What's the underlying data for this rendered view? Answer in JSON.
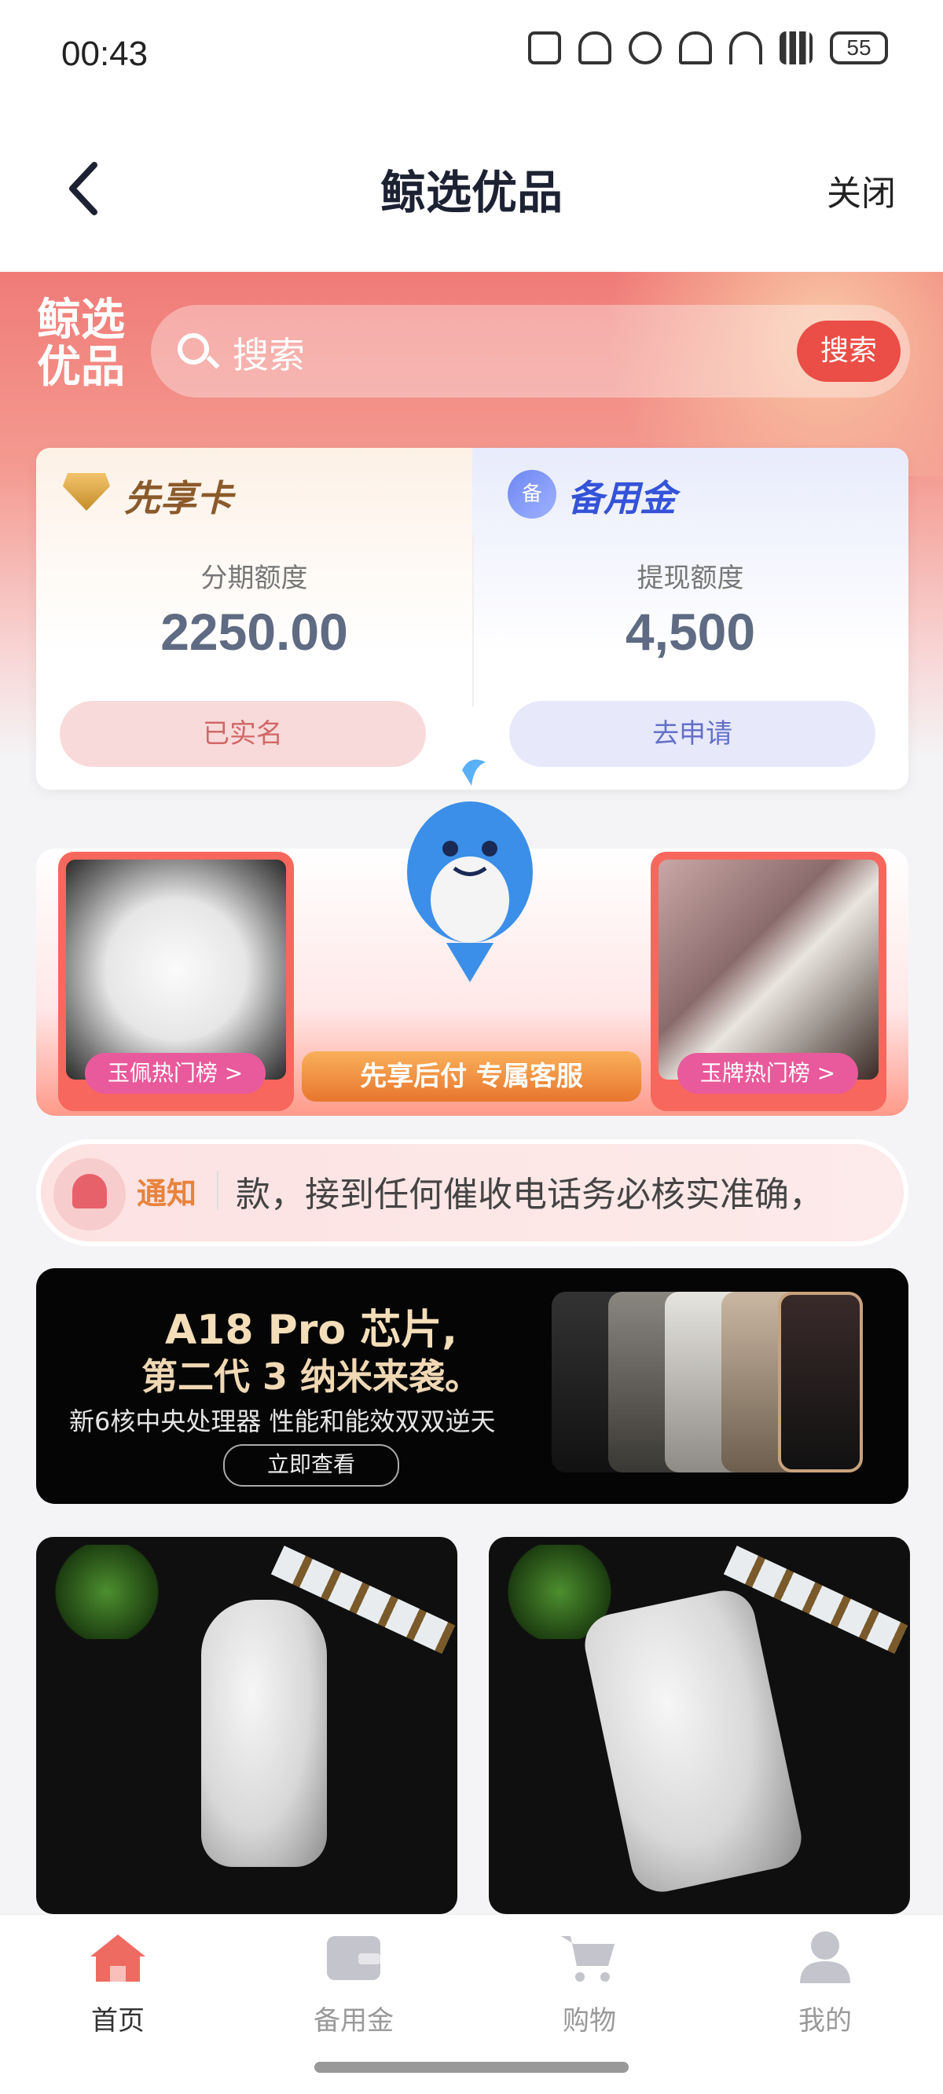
{
  "status_bar": {
    "time": "00:43",
    "battery": "55"
  },
  "nav": {
    "title": "鲸选优品",
    "close_label": "关闭"
  },
  "header": {
    "logo_text": "鲸选优品",
    "search_placeholder": "搜索",
    "search_button": "搜索"
  },
  "card": {
    "left": {
      "title": "先享卡",
      "sub_label": "分期额度",
      "value": "2250.00",
      "button": "已实名"
    },
    "right": {
      "icon_text": "备",
      "title": "备用金",
      "sub_label": "提现额度",
      "value": "4,500",
      "button": "去申请"
    }
  },
  "promo": {
    "left_tag": "玉佩热门榜 >",
    "right_tag": "玉牌热门榜 >",
    "center_button": "先享后付 专属客服"
  },
  "notice": {
    "label": "通知",
    "text": "款，接到任何催收电话务必核实准确，"
  },
  "ad": {
    "title": "A18 Pro 芯片,",
    "subtitle": "第二代 3 纳米来袭。",
    "desc": "新6核中央处理器  性能和能效双双逆天",
    "button": "立即查看"
  },
  "tabs": [
    {
      "label": "首页",
      "icon": "home-icon",
      "active": true
    },
    {
      "label": "备用金",
      "icon": "wallet-icon",
      "active": false
    },
    {
      "label": "购物",
      "icon": "cart-icon",
      "active": false
    },
    {
      "label": "我的",
      "icon": "user-icon",
      "active": false
    }
  ],
  "colors": {
    "accent": "#ea4e47",
    "header": "#f07b78",
    "tab_active": "#ee6b62"
  }
}
